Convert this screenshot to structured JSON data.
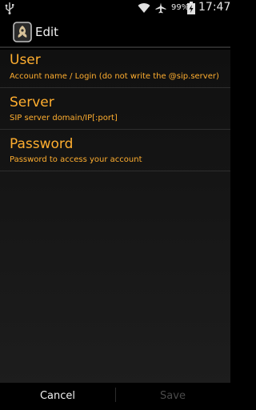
{
  "status_bar": {
    "battery_percent": "99%",
    "time": "17:47",
    "icons": [
      "usb-icon",
      "wifi-icon",
      "airplane-mode-icon",
      "battery-charging-icon"
    ]
  },
  "action_bar": {
    "app_icon": "sip-app-icon",
    "title": "Edit"
  },
  "preferences": [
    {
      "title": "User",
      "summary": "Account name / Login (do not write the @sip.server)"
    },
    {
      "title": "Server",
      "summary": "SIP server domain/IP[:port]"
    },
    {
      "title": "Password",
      "summary": "Password to access your account"
    }
  ],
  "buttons": {
    "cancel": "Cancel",
    "save": "Save"
  },
  "colors": {
    "accent": "#ffae2f",
    "background": "#000000",
    "disabled_text": "#4a4a4a"
  }
}
